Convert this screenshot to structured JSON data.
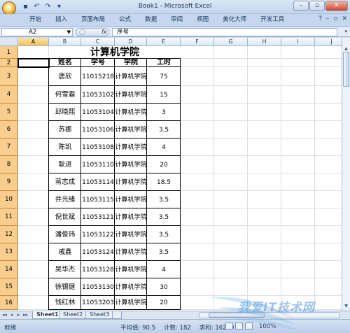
{
  "window": {
    "title": "Book1 - Microsoft Excel",
    "controls": [
      "–",
      "▫",
      "✕"
    ]
  },
  "qat": {
    "icons": [
      "save-icon",
      "undo-icon",
      "redo-icon",
      "customize-icon"
    ],
    "glyphs": [
      "▪",
      "↶",
      "↷",
      "▾"
    ]
  },
  "ribbon": {
    "tabs": [
      "开始",
      "插入",
      "页面布局",
      "公式",
      "数据",
      "审阅",
      "视图",
      "美化大师",
      "开发工具"
    ],
    "help_glyphs": [
      "?",
      "–",
      "▫",
      "✕"
    ]
  },
  "formula_bar": {
    "name_box": "A2",
    "fx": "fx",
    "formula": "序号"
  },
  "columns": [
    "A",
    "B",
    "C",
    "D",
    "E",
    "F",
    "G",
    "H",
    "I",
    "J",
    "K"
  ],
  "rows": [
    "1",
    "2",
    "3",
    "4",
    "5",
    "6",
    "7",
    "8",
    "9",
    "10",
    "11",
    "12",
    "13",
    "14",
    "15",
    "16"
  ],
  "table": {
    "title": "计算机学院",
    "headers": [
      "姓名",
      "学号",
      "学院",
      "工时"
    ],
    "records": [
      [
        "唐欣",
        "11015218",
        "计算机学院",
        "75"
      ],
      [
        "何雪霜",
        "11053102",
        "计算机学院",
        "15"
      ],
      [
        "邱晓熙",
        "11053104",
        "计算机学院",
        "3"
      ],
      [
        "苏娜",
        "11053106",
        "计算机学院",
        "3.5"
      ],
      [
        "陈凯",
        "11053108",
        "计算机学院",
        "4"
      ],
      [
        "耿进",
        "11053110",
        "计算机学院",
        "20"
      ],
      [
        "蒋志成",
        "11053114",
        "计算机学院",
        "18.5"
      ],
      [
        "井光绪",
        "11053115",
        "计算机学院",
        "3.5"
      ],
      [
        "倪世斌",
        "11053121",
        "计算机学院",
        "3.5"
      ],
      [
        "潘俊玮",
        "11053122",
        "计算机学院",
        "3.5"
      ],
      [
        "戚鑫",
        "11053124",
        "计算机学院",
        "3.5"
      ],
      [
        "吴华杰",
        "11053128",
        "计算机学院",
        "4"
      ],
      [
        "徐锡健",
        "11053130",
        "计算机学院",
        "30"
      ],
      [
        "钱红林",
        "11053203",
        "计算机学院",
        "20"
      ]
    ]
  },
  "sheets": {
    "tabs": [
      "Sheet1",
      "Sheet2",
      "Sheet3"
    ],
    "active": "Sheet1",
    "nav": [
      "◂◂",
      "◂",
      "▸",
      "▸▸"
    ]
  },
  "status": {
    "ready": "就绪",
    "average": "平均值: 90.5",
    "count": "计数: 182",
    "sum": "求和: 16290",
    "zoom": "100%"
  },
  "watermark": "我爱IT技术网"
}
